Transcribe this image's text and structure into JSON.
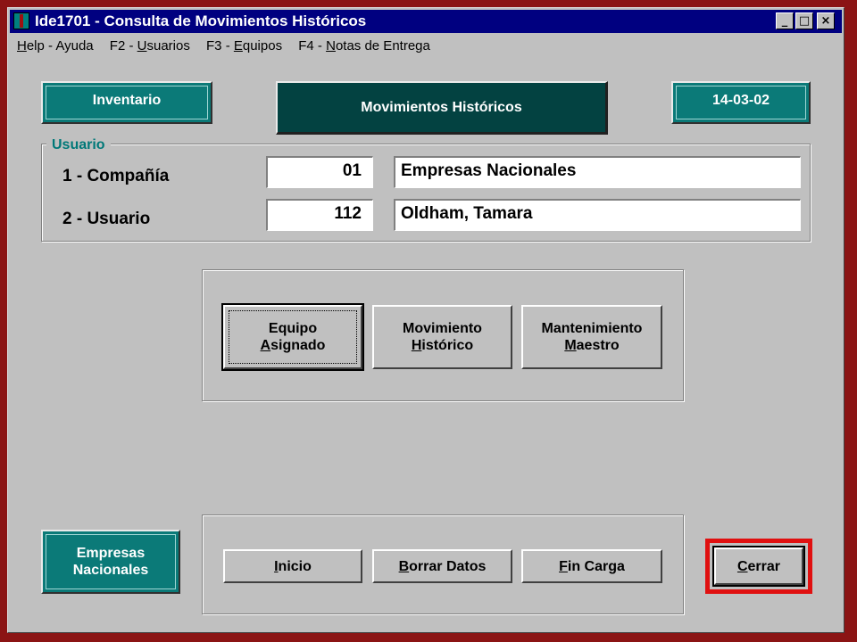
{
  "window": {
    "title": "Ide1701 - Consulta de Movimientos Históricos",
    "controls": {
      "minimize": "_",
      "maximize": "□",
      "close": "×"
    }
  },
  "menu": [
    {
      "prefix": "",
      "key": "H",
      "rest": "elp - Ayuda"
    },
    {
      "prefix": "F2 - ",
      "key": "U",
      "rest": "suarios"
    },
    {
      "prefix": "F3 - ",
      "key": "E",
      "rest": "quipos"
    },
    {
      "prefix": "F4 - ",
      "key": "N",
      "rest": "otas de Entrega"
    }
  ],
  "header": {
    "left_badge": "Inventario",
    "center_title": "Movimientos Históricos",
    "date_badge": "14-03-02"
  },
  "usuario_group": {
    "legend": "Usuario",
    "rows": [
      {
        "label": "1 - Compañía",
        "code": "01",
        "name": "Empresas Nacionales"
      },
      {
        "label": "2 - Usuario",
        "code": "112",
        "name": "Oldham, Tamara"
      }
    ]
  },
  "options": [
    {
      "line1": "Equipo",
      "key": "A",
      "rest2": "signado"
    },
    {
      "line1": "Movimiento",
      "key": "H",
      "rest2": "istórico"
    },
    {
      "line1": "Mantenimiento",
      "key": "M",
      "rest2": "aestro"
    }
  ],
  "footer": {
    "company_badge_line1": "Empresas",
    "company_badge_line2": "Nacionales",
    "actions": [
      {
        "key": "I",
        "rest": "nicio"
      },
      {
        "key": "B",
        "rest": "orrar Datos"
      },
      {
        "key": "F",
        "rest": "in Carga"
      }
    ],
    "close": {
      "key": "C",
      "rest": "errar"
    }
  },
  "colors": {
    "desktop": "#8b1414",
    "titlebar": "#000080",
    "teal": "#0b7a78",
    "dark_teal": "#034241",
    "close_highlight": "#e01010"
  }
}
